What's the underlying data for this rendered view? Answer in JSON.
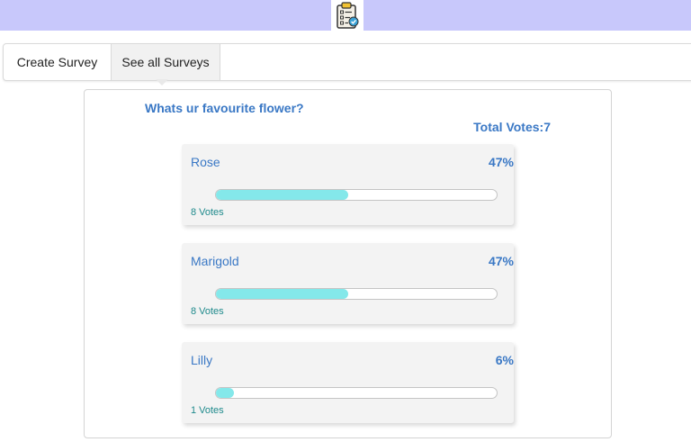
{
  "header": {
    "logo_icon": "clipboard-check-icon",
    "background_color": "#c8c8fb"
  },
  "tabs": [
    {
      "label": "Create Survey",
      "active": false
    },
    {
      "label": "See all Surveys",
      "active": true
    }
  ],
  "survey": {
    "question": "Whats ur favourite flower?",
    "total_label": "Total Votes:",
    "total_votes": "7",
    "options": [
      {
        "label": "Rose",
        "percent_label": "47%",
        "fill_fraction": 0.47,
        "votes": "8",
        "votes_label": "Votes"
      },
      {
        "label": "Marigold",
        "percent_label": "47%",
        "fill_fraction": 0.47,
        "votes": "8",
        "votes_label": "Votes"
      },
      {
        "label": "Lilly",
        "percent_label": "6%",
        "fill_fraction": 0.06,
        "votes": "1",
        "votes_label": "Votes"
      }
    ],
    "bar_color": "#84e8ea",
    "accent_color": "#3a78c5"
  }
}
